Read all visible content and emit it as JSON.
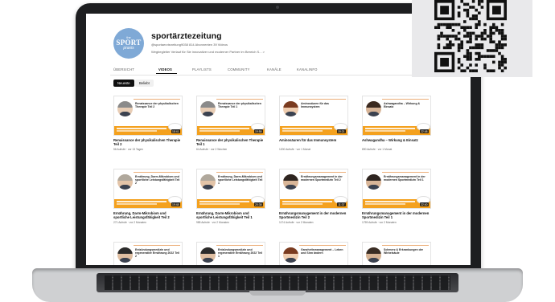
{
  "channel": {
    "logo_small": "the",
    "logo_main": "SPORT",
    "logo_sub": "praxis",
    "name": "sportärztezeitung",
    "meta": "@sportaerztezeitung9038  814 Abonnenten  39 Videos",
    "description": "Wegbegleiter Verlauf für Sie innovativer und moderner Partner im Bereich S...  >"
  },
  "tabs": [
    "ÜBERSICHT",
    "VIDEOS",
    "PLAYLISTS",
    "COMMUNITY",
    "KANÄLE",
    "KANALINFO"
  ],
  "filters": [
    "Neueste",
    "Beliebt"
  ],
  "videos": [
    {
      "title": "Renaissance der physikalischen Therapie Teil 2",
      "meta": "56 Aufrufe · vor 13 Tagen",
      "duration": "18:41",
      "thumb_title": "Renaissance der physikalischen Therapie Teil 2",
      "hair": "#8a8a8a",
      "face": "#e8cdb5"
    },
    {
      "title": "Renaissance der physikalischen Therapie Teil 1",
      "meta": "64 Aufrufe · vor 2 Wochen",
      "duration": "19:58",
      "thumb_title": "Renaissance der physikalischen Therapie Teil 1",
      "hair": "#8a8a8a",
      "face": "#e8cdb5"
    },
    {
      "title": "Aminosäuren für das Immunsystem",
      "meta": "1200 Aufrufe · vor 1 Monat",
      "duration": "19:21",
      "thumb_title": "Aminosäuren für das Immunsystem",
      "hair": "#7a3b20",
      "face": "#efcdb0"
    },
    {
      "title": "Ashwagandha – Wirkung & Einsatz",
      "meta": "890 Aufrufe · vor 1 Monat",
      "duration": "22:48",
      "thumb_title": "Ashwagandha – Wirkung & Einsatz",
      "hair": "#3b2a20",
      "face": "#d7b497"
    },
    {
      "title": "Ernährung, Darm-Mikrobiom und sportliche Leistungsfähigkeit Teil 2",
      "meta": "271 Aufrufe · vor 2 Monaten",
      "duration": "19:48",
      "thumb_title": "Ernährung, Darm-Mikrobiom und sportliche Leistungsfähigkeit Teil 2",
      "hair": "#b0a89c",
      "face": "#e3c4a8"
    },
    {
      "title": "Ernährung, Darm-Mikrobiom und sportliche Leistungsfähigkeit Teil 1",
      "meta": "985 Aufrufe · vor 2 Monaten",
      "duration": "20:38",
      "thumb_title": "Ernährung, Darm-Mikrobiom und sportliche Leistungsfähigkeit Teil 1",
      "hair": "#b0a89c",
      "face": "#e3c4a8"
    },
    {
      "title": "Ernährungsmanagement in der modernen Sportmedizin Teil 2",
      "meta": "1174 Aufrufe · vor 2 Monaten",
      "duration": "11:37",
      "thumb_title": "Ernährungsmanagement in der modernen Sportmedizin Teil 2",
      "hair": "#2e2520",
      "face": "#d9b698"
    },
    {
      "title": "Ernährungsmanagement in der modernen Sportmedizin Teil 1",
      "meta": "1759 Aufrufe · vor 2 Monaten",
      "duration": "22:40",
      "thumb_title": "Ernährungsmanagement in der modernen Sportmedizin Teil 1",
      "hair": "#2e2520",
      "face": "#d9b698"
    },
    {
      "title": "",
      "meta": "",
      "duration": "",
      "thumb_title": "Entzündungsmedizin und regenerative Ernährung 2022 Teil 2",
      "hair": "#2b2b2b",
      "face": "#e0bfa2"
    },
    {
      "title": "",
      "meta": "",
      "duration": "",
      "thumb_title": "Entzündungsmedizin und regenerative Ernährung 2022 Teil 1",
      "hair": "#2b2b2b",
      "face": "#e0bfa2"
    },
    {
      "title": "",
      "meta": "",
      "duration": "",
      "thumb_title": "Ganzheitsmanagement – Leben und Sinn ändern",
      "hair": "#7a3b20",
      "face": "#efcdb0"
    },
    {
      "title": "",
      "meta": "",
      "duration": "",
      "thumb_title": "Schmerz & Erkrankungen der Wirbelsäule",
      "hair": "#3a2d24",
      "face": "#d6b394"
    }
  ]
}
